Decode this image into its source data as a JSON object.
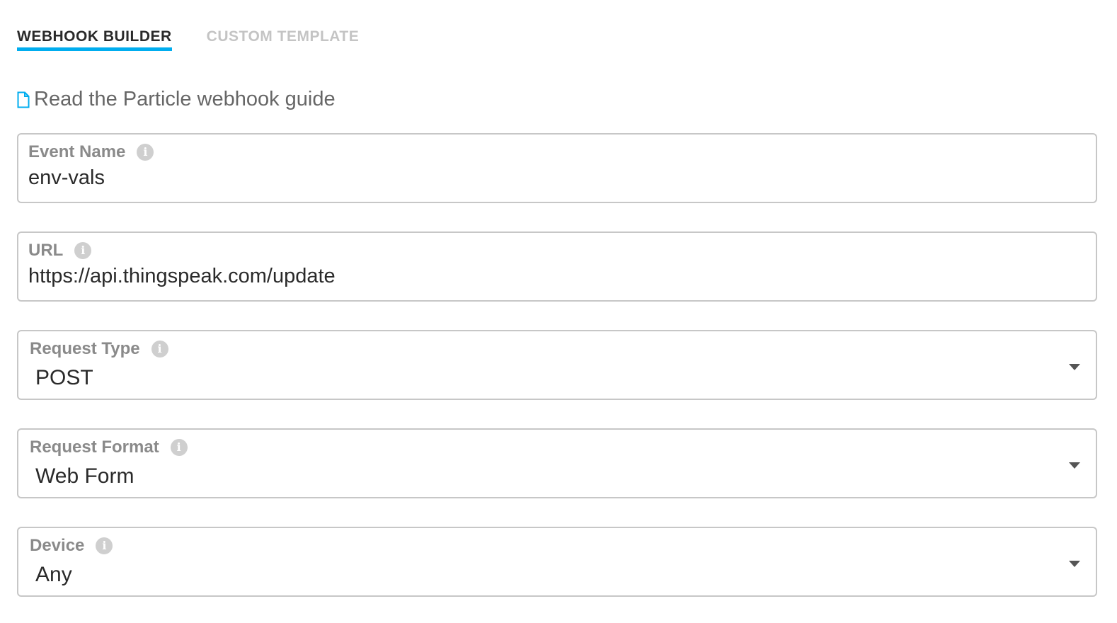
{
  "tabs": [
    {
      "label": "WEBHOOK BUILDER",
      "active": true
    },
    {
      "label": "CUSTOM TEMPLATE",
      "active": false
    }
  ],
  "guide": {
    "label": "Read the Particle webhook guide",
    "icon": "document-icon"
  },
  "fields": {
    "event_name": {
      "label": "Event Name",
      "value": "env-vals"
    },
    "url": {
      "label": "URL",
      "value": "https://api.thingspeak.com/update"
    },
    "request_type": {
      "label": "Request Type",
      "value": "POST"
    },
    "request_format": {
      "label": "Request Format",
      "value": "Web Form"
    },
    "device": {
      "label": "Device",
      "value": "Any"
    }
  },
  "colors": {
    "accent": "#00adef",
    "inactive_tab": "#c4c4c4",
    "label": "#8a8a8a",
    "border": "#c7c7c7"
  }
}
